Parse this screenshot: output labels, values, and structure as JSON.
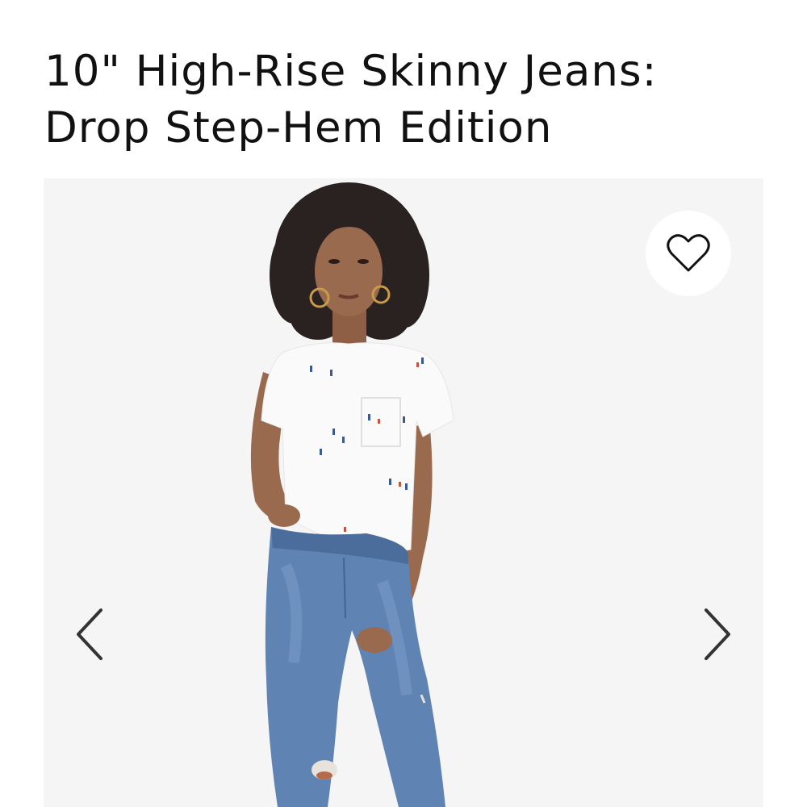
{
  "product": {
    "title_line1": "10\" High-Rise Skinny Jeans:",
    "title_line2": "Drop Step-Hem Edition"
  },
  "gallery": {
    "photo": "model-wearing-jeans",
    "favorite_icon": "heart-outline-icon",
    "prev_icon": "chevron-left-icon",
    "next_icon": "chevron-right-icon"
  },
  "colors": {
    "text": "#111111",
    "gallery_bg": "#f5f5f5",
    "denim": "#5f83b3",
    "shirt": "#fafafa",
    "hair": "#2a2220",
    "skin": "#9a6a4e"
  }
}
